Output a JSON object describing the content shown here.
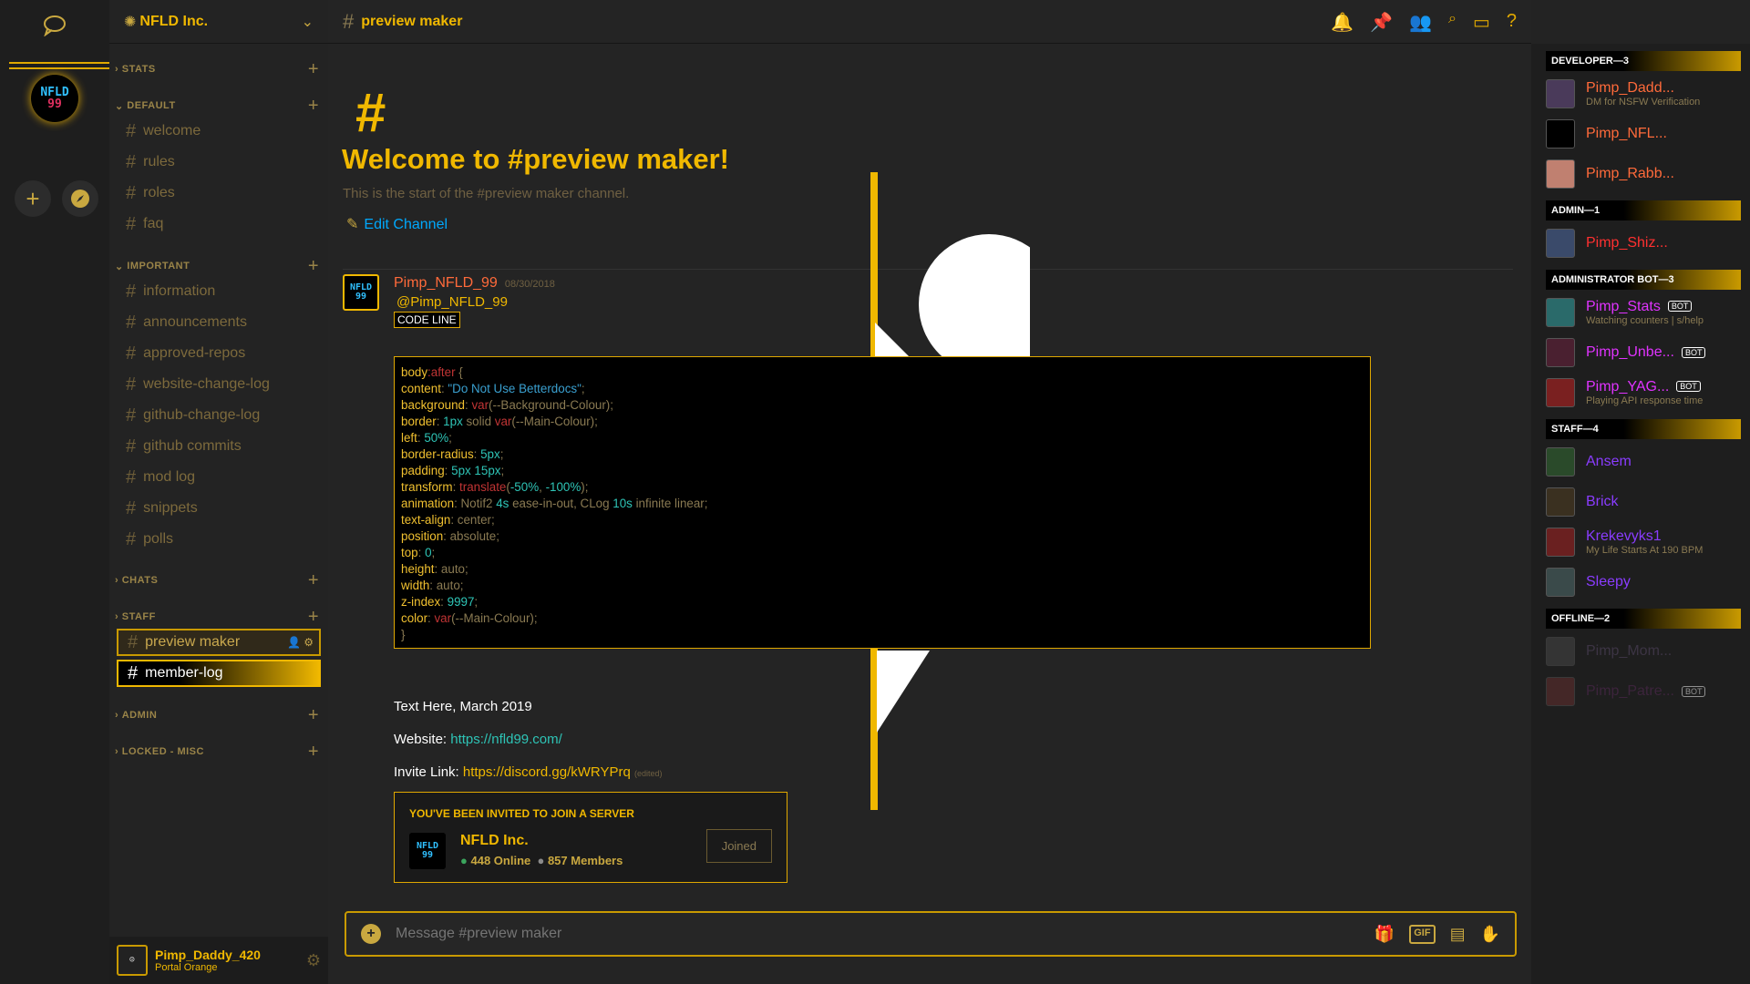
{
  "server": {
    "name": "NFLD Inc.",
    "icon_text_1": "NFLD",
    "icon_text_2": "99"
  },
  "categories": [
    {
      "label": "STATS"
    },
    {
      "label": "DEFAULT"
    },
    {
      "label": "IMPORTANT"
    },
    {
      "label": "CHATS"
    },
    {
      "label": "STAFF"
    },
    {
      "label": "ADMIN"
    },
    {
      "label": "LOCKED - MISC"
    }
  ],
  "channels": {
    "default": [
      "welcome",
      "rules",
      "roles",
      "faq"
    ],
    "important": [
      "information",
      "announcements",
      "approved-repos",
      "website-change-log",
      "github-change-log",
      "github commits",
      "mod log",
      "snippets",
      "polls"
    ],
    "staff": [
      "preview maker",
      "member-log"
    ]
  },
  "user": {
    "name": "Pimp_Daddy_420",
    "status": "Portal Orange"
  },
  "header": {
    "channel": "preview maker"
  },
  "welcome": {
    "hash": "#",
    "title": "Welcome to #preview maker!",
    "subtitle": "This is the start of the #preview maker channel.",
    "edit": "Edit Channel"
  },
  "message": {
    "author": "Pimp_NFLD_99",
    "date": "08/30/2018",
    "mention": "@Pimp_NFLD_99",
    "codeline": "CODE LINE",
    "text1": "Text Here, March 2019",
    "website_label": "Website: ",
    "website": "https://nfld99.com/",
    "invite_label": "Invite Link: ",
    "invite": "https://discord.gg/kWRYPrq",
    "edited": "(edited)"
  },
  "invite": {
    "header": "YOU'VE BEEN INVITED TO JOIN A SERVER",
    "name": "NFLD Inc.",
    "online": "448 Online",
    "members": "857 Members",
    "button": "Joined"
  },
  "composer": {
    "placeholder": "Message #preview maker"
  },
  "members": {
    "groups": [
      {
        "label": "DEVELOPER—3",
        "members": [
          {
            "name": "Pimp_Dadd...",
            "status": "DM for NSFW Verification",
            "color": "#ff6a3a"
          },
          {
            "name": "Pimp_NFL...",
            "status": "",
            "color": "#ff6a3a"
          },
          {
            "name": "Pimp_Rabb...",
            "status": "",
            "color": "#ff6a3a"
          }
        ]
      },
      {
        "label": "ADMIN—1",
        "members": [
          {
            "name": "Pimp_Shiz...",
            "status": "",
            "color": "#ff3030"
          }
        ]
      },
      {
        "label": "ADMINISTRATOR BOT—3",
        "members": [
          {
            "name": "Pimp_Stats",
            "status": "Watching counters | s/help",
            "color": "#e033ff",
            "bot": "BOT"
          },
          {
            "name": "Pimp_Unbe...",
            "status": "",
            "color": "#e033ff",
            "bot": "BOT"
          },
          {
            "name": "Pimp_YAG...",
            "status": "Playing API response time",
            "color": "#e033ff",
            "bot": "BOT"
          }
        ]
      },
      {
        "label": "STAFF—4",
        "members": [
          {
            "name": "Ansem",
            "status": "",
            "color": "#8a3cff"
          },
          {
            "name": "Brick",
            "status": "",
            "color": "#8a3cff"
          },
          {
            "name": "Krekevyks1",
            "status": "My Life Starts At 190 BPM",
            "color": "#8a3cff"
          },
          {
            "name": "Sleepy",
            "status": "",
            "color": "#8a3cff"
          }
        ]
      },
      {
        "label": "OFFLINE—2",
        "members": [
          {
            "name": "Pimp_Mom...",
            "status": "",
            "color": "#5a4a6a"
          },
          {
            "name": "Pimp_Patre...",
            "status": "",
            "color": "#5a2a5a",
            "bot": "BOT"
          }
        ]
      }
    ]
  },
  "colors": {
    "accent": "#f0b800",
    "link": "#00a8fc",
    "bg": "#232323"
  }
}
